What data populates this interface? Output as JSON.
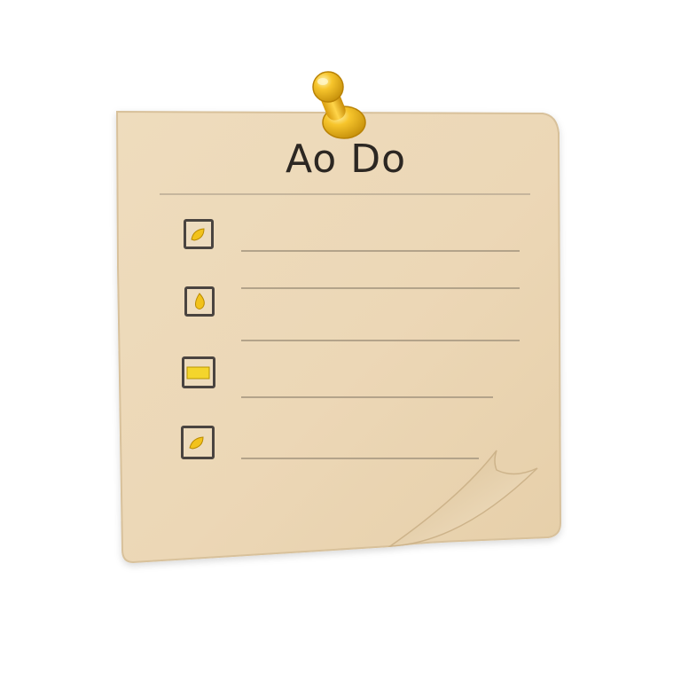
{
  "note": {
    "title": "Ao Do",
    "paper_color": "#efdcbc",
    "pin_color": "#f0b81f",
    "items": [
      {
        "checked_style": "leaf"
      },
      {
        "checked_style": "drop"
      },
      {
        "checked_style": "bar"
      },
      {
        "checked_style": "leaf"
      }
    ]
  }
}
